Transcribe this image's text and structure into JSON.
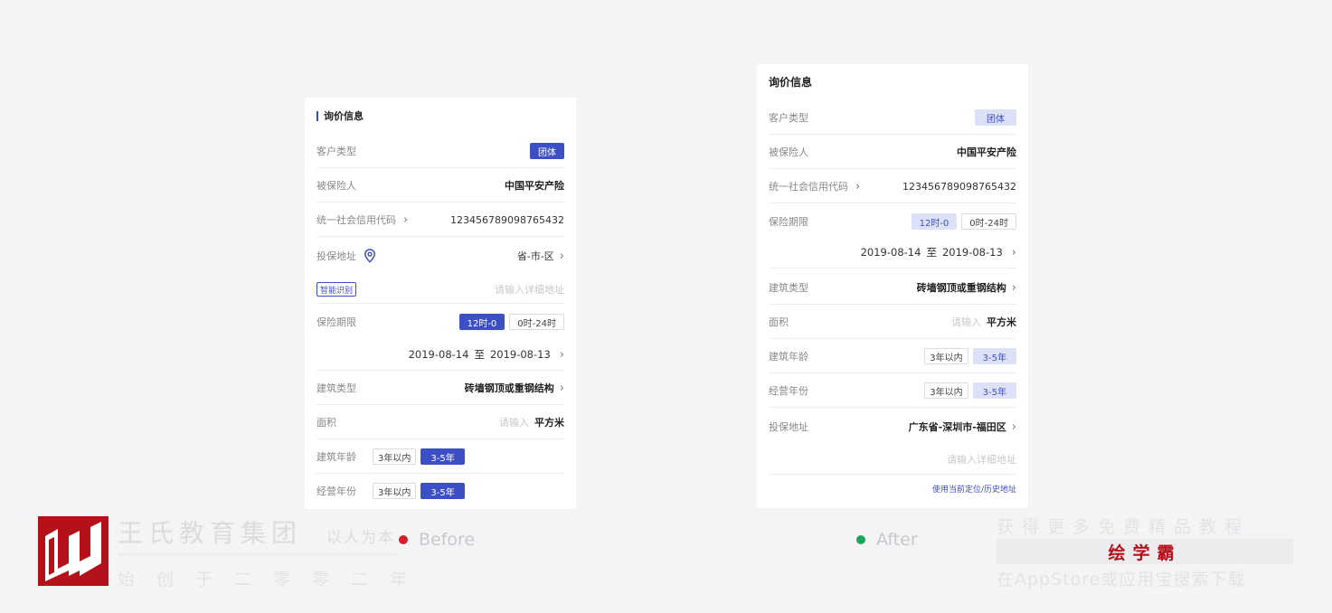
{
  "before": {
    "section_title": "询价信息",
    "customer_type": {
      "label": "客户类型",
      "value": "团体"
    },
    "insured": {
      "label": "被保险人",
      "value": "中国平安产险"
    },
    "credit_code": {
      "label": "统一社会信用代码",
      "value": "123456789098765432"
    },
    "address": {
      "label": "投保地址",
      "value": "省-市-区"
    },
    "smart_recognize": "智能识别",
    "address_detail_placeholder": "请输入详细地址",
    "period": {
      "label": "保险期限",
      "opt1": "12时-0",
      "opt2": "0时-24时",
      "start": "2019-08-14",
      "to": "至",
      "end": "2019-08-13"
    },
    "building_type": {
      "label": "建筑类型",
      "value": "砖墙钢顶或重钢结构"
    },
    "area": {
      "label": "面积",
      "placeholder": "请输入",
      "unit": "平方米"
    },
    "building_age": {
      "label": "建筑年龄",
      "opt1": "3年以内",
      "opt2": "3-5年"
    },
    "operating_years": {
      "label": "经营年份",
      "opt1": "3年以内",
      "opt2": "3-5年"
    }
  },
  "after": {
    "section_title": "询价信息",
    "customer_type": {
      "label": "客户类型",
      "value": "团体"
    },
    "insured": {
      "label": "被保险人",
      "value": "中国平安产险"
    },
    "credit_code": {
      "label": "统一社会信用代码",
      "value": "123456789098765432"
    },
    "period": {
      "label": "保险期限",
      "opt1": "12时-0",
      "opt2": "0时-24时",
      "start": "2019-08-14",
      "to": "至",
      "end": "2019-08-13"
    },
    "building_type": {
      "label": "建筑类型",
      "value": "砖墙钢顶或重钢结构"
    },
    "area": {
      "label": "面积",
      "placeholder": "请输入",
      "unit": "平方米"
    },
    "building_age": {
      "label": "建筑年龄",
      "opt1": "3年以内",
      "opt2": "3-5年"
    },
    "operating_years": {
      "label": "经营年份",
      "opt1": "3年以内",
      "opt2": "3-5年"
    },
    "address": {
      "label": "投保地址",
      "value": "广东省-深圳市-福田区"
    },
    "address_detail_placeholder": "请输入详细地址",
    "location_link": "使用当前定位/历史地址"
  },
  "legend": {
    "before": {
      "label": "Before",
      "color": "#d81e2a"
    },
    "after": {
      "label": "After",
      "color": "#1aa65a"
    }
  },
  "watermark": {
    "brand": "王氏教育集团",
    "motto": "以人为本",
    "since": "始创于二零零二年",
    "promo_line1": "获得更多免费精品教程",
    "promo_brand": "绘学霸",
    "promo_line3": "在AppStore或应用宝搜索下载"
  },
  "colors": {
    "accent": "#3d4fc4",
    "accent_soft": "#dde1f7",
    "logo_red": "#b3121a"
  }
}
